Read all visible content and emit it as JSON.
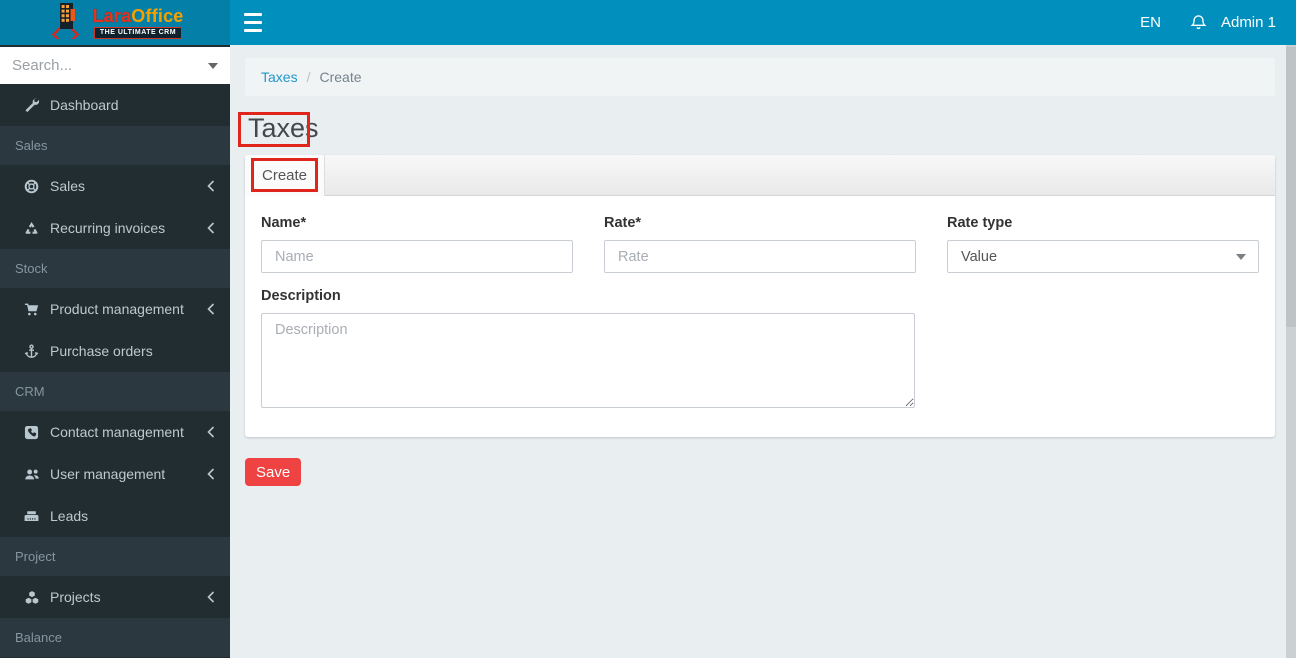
{
  "header": {
    "logo": {
      "brand_primary": "Lara",
      "brand_secondary": "Office",
      "tagline": "THE ULTIMATE CRM"
    },
    "language": "EN",
    "user": "Admin 1"
  },
  "sidebar": {
    "search_placeholder": "Search...",
    "items": [
      {
        "kind": "link",
        "label": "Dashboard",
        "icon": "wrench-icon",
        "expandable": false
      },
      {
        "kind": "section",
        "label": "Sales"
      },
      {
        "kind": "link",
        "label": "Sales",
        "icon": "life-ring-icon",
        "expandable": true
      },
      {
        "kind": "link",
        "label": "Recurring invoices",
        "icon": "recycle-icon",
        "expandable": true
      },
      {
        "kind": "section",
        "label": "Stock"
      },
      {
        "kind": "link",
        "label": "Product management",
        "icon": "shopping-cart-icon",
        "expandable": true
      },
      {
        "kind": "link",
        "label": "Purchase orders",
        "icon": "anchor-icon",
        "expandable": false
      },
      {
        "kind": "section",
        "label": "CRM"
      },
      {
        "kind": "link",
        "label": "Contact management",
        "icon": "phone-square-icon",
        "expandable": true
      },
      {
        "kind": "link",
        "label": "User management",
        "icon": "users-icon",
        "expandable": true
      },
      {
        "kind": "link",
        "label": "Leads",
        "icon": "fax-icon",
        "expandable": false
      },
      {
        "kind": "section",
        "label": "Project"
      },
      {
        "kind": "link",
        "label": "Projects",
        "icon": "cubes-icon",
        "expandable": true
      },
      {
        "kind": "section",
        "label": "Balance"
      }
    ]
  },
  "breadcrumb": {
    "link": "Taxes",
    "separator": "/",
    "current": "Create"
  },
  "page": {
    "title": "Taxes"
  },
  "card": {
    "tab_label": "Create"
  },
  "form": {
    "name": {
      "label": "Name*",
      "placeholder": "Name",
      "value": ""
    },
    "rate": {
      "label": "Rate*",
      "placeholder": "Rate",
      "value": ""
    },
    "rate_type": {
      "label": "Rate type",
      "selected_option": "Value"
    },
    "description": {
      "label": "Description",
      "placeholder": "Description",
      "value": ""
    }
  },
  "actions": {
    "save_label": "Save"
  },
  "colors": {
    "navbar": "#0190bd",
    "logo_background": "#0480a8",
    "sidebar_background": "#222d32",
    "sidebar_section_background": "#2c3840",
    "breadcrumb_link": "#2197cb",
    "save_button": "#ef4242",
    "annotation_box": "#e0251c",
    "content_background": "#e9eef1"
  }
}
